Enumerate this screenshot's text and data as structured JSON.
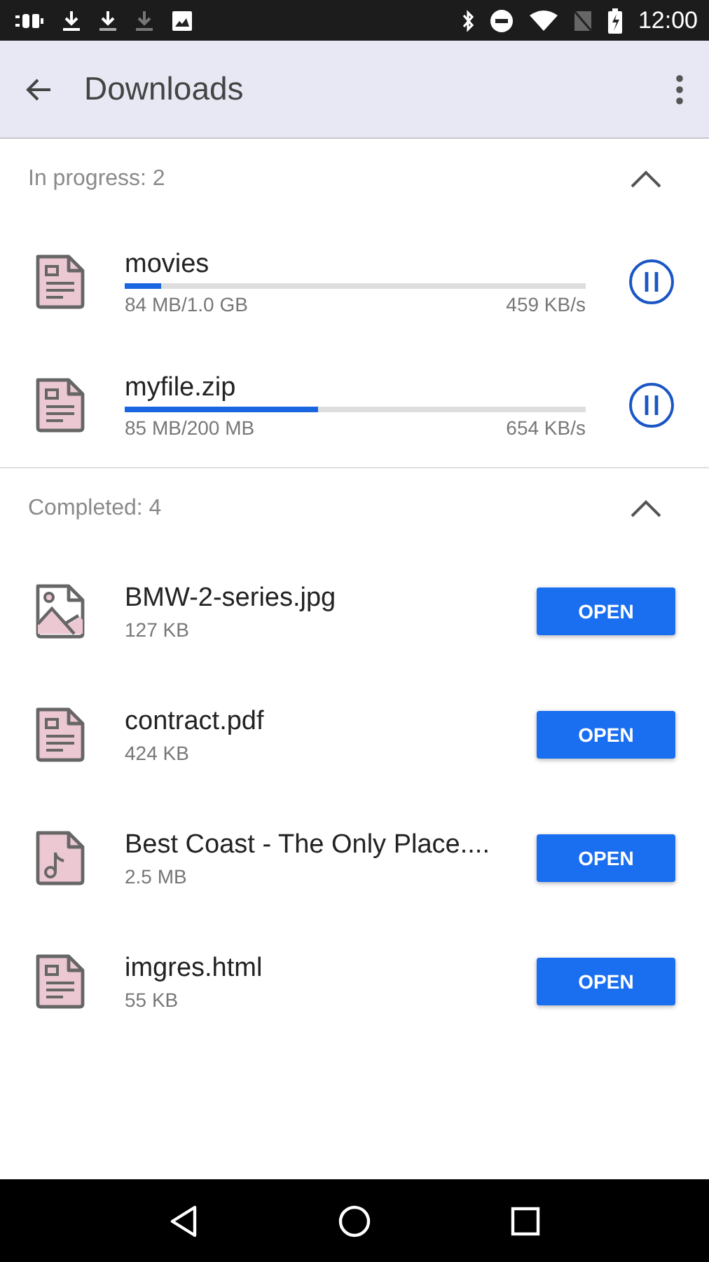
{
  "status_bar": {
    "time": "12:00"
  },
  "app_bar": {
    "title": "Downloads"
  },
  "sections": [
    {
      "kind": "progress",
      "label": "In progress: 2",
      "expanded": true,
      "items": [
        {
          "kind": "document",
          "name": "movies",
          "size": "84 MB/1.0 GB",
          "speed": "459 KB/s",
          "level": 0.08
        },
        {
          "kind": "document",
          "name": "myfile.zip",
          "size": "85 MB/200 MB",
          "speed": "654 KB/s",
          "level": 0.42
        }
      ]
    },
    {
      "kind": "completed",
      "label": "Completed: 4",
      "expanded": true,
      "items": [
        {
          "kind": "image",
          "name": "BMW-2-series.jpg",
          "size": "127 KB",
          "action": "OPEN"
        },
        {
          "kind": "document",
          "name": "contract.pdf",
          "size": "424 KB",
          "action": "OPEN"
        },
        {
          "kind": "audio",
          "name": "Best Coast - The Only Place....",
          "size": "2.5 MB",
          "action": "OPEN"
        },
        {
          "kind": "document",
          "name": "imgres.html",
          "size": "55 KB",
          "action": "OPEN"
        }
      ]
    }
  ]
}
